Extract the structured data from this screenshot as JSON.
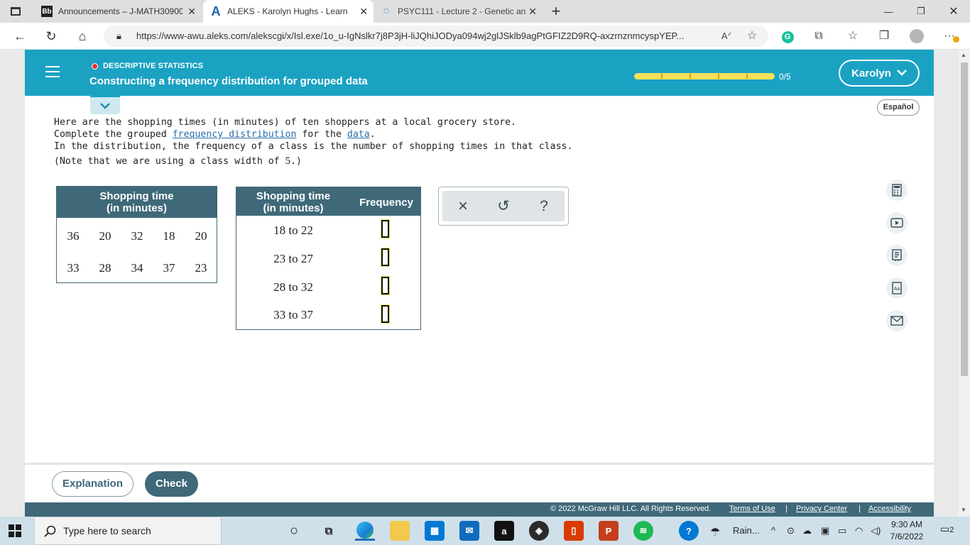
{
  "browser": {
    "tabs": [
      {
        "favicon": "Bb",
        "title": "Announcements – J-MATH30900",
        "close": "✕"
      },
      {
        "favicon": "A",
        "title": "ALEKS - Karolyn Hughs - Learn",
        "close": "✕"
      },
      {
        "favicon": "○",
        "title": "PSYC111 - Lecture 2 - Genetic an",
        "close": "✕"
      }
    ],
    "new_tab": "+",
    "url": "https://www-awu.aleks.com/alekscgi/x/Isl.exe/1o_u-IgNslkr7j8P3jH-liJQhiJODya094wj2glJSklb9agPtGFIZ2D9RQ-axzrnznmcyspYEP...",
    "window_controls": {
      "minimize": "—",
      "restore": "❐",
      "close": "✕"
    }
  },
  "aleks": {
    "topic": "DESCRIPTIVE STATISTICS",
    "title": "Constructing a frequency distribution for grouped data",
    "progress": {
      "text": "0/5",
      "value": 0,
      "total": 5
    },
    "user": "Karolyn",
    "espanol": "Español"
  },
  "prompt": {
    "line1": "Here are the shopping times (in minutes) of ten shoppers at a local grocery store.",
    "line2_before": "Complete the grouped ",
    "line2_link1": "frequency distribution",
    "line2_mid": " for the ",
    "line2_link2": "data",
    "line2_after": ".",
    "line3": "In the distribution, the frequency of a class is the number of shopping times in that class.",
    "line4_before": "(Note that we are using a class width of ",
    "line4_value": "5",
    "line4_after": ".)"
  },
  "data_table": {
    "header_line1": "Shopping time",
    "header_line2": "(in minutes)",
    "rows": [
      [
        "36",
        "20",
        "32",
        "18",
        "20"
      ],
      [
        "33",
        "28",
        "34",
        "37",
        "23"
      ]
    ]
  },
  "freq_table": {
    "col1_line1": "Shopping time",
    "col1_line2": "(in minutes)",
    "col2": "Frequency",
    "classes": [
      "18 to 22",
      "23 to 27",
      "28 to 32",
      "33 to 37"
    ],
    "frequencies": [
      "",
      "",
      "",
      ""
    ]
  },
  "tools": {
    "clear": "×",
    "undo": "↺",
    "help": "?"
  },
  "footer": {
    "explanation": "Explanation",
    "check": "Check",
    "copyright": "© 2022 McGraw Hill LLC. All Rights Reserved.",
    "terms": "Terms of Use",
    "privacy": "Privacy Center",
    "accessibility": "Accessibility",
    "sep": "|"
  },
  "taskbar": {
    "search_placeholder": "Type here to search",
    "weather": "Rain...",
    "time": "9:30 AM",
    "date": "7/6/2022",
    "notifications": "2"
  }
}
